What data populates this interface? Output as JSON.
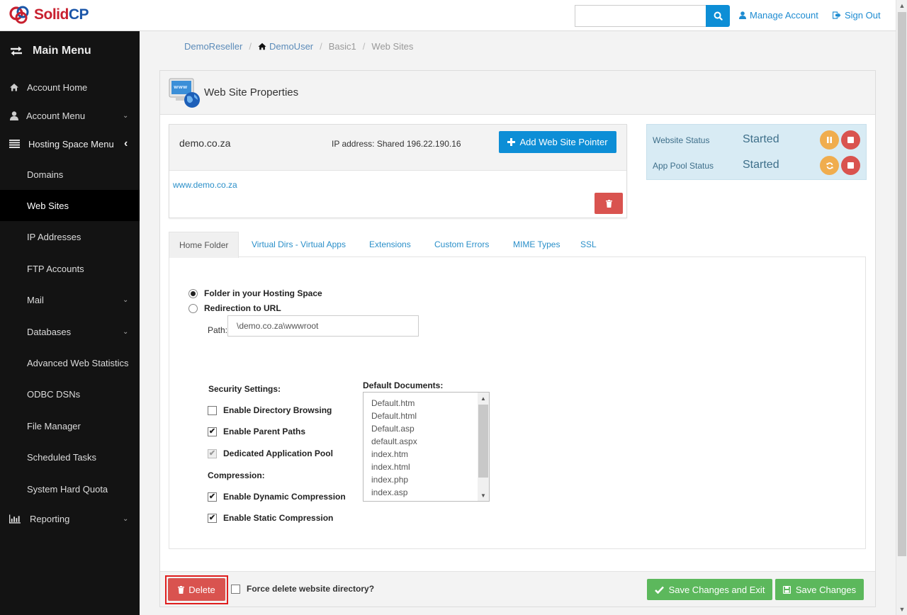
{
  "header": {
    "logo_solid": "Solid",
    "logo_cp": "CP",
    "search": {
      "value": "",
      "placeholder": ""
    },
    "manage_account": "Manage Account",
    "sign_out": "Sign Out"
  },
  "sidebar": {
    "title": "Main Menu",
    "items": [
      {
        "label": "Account Home",
        "icon": "home-icon"
      },
      {
        "label": "Account Menu",
        "icon": "user-icon",
        "chevron": "down"
      },
      {
        "label": "Hosting Space Menu",
        "icon": "list-icon",
        "chevron": "left"
      },
      {
        "label": "Domains"
      },
      {
        "label": "Web Sites",
        "active": true
      },
      {
        "label": "IP Addresses"
      },
      {
        "label": "FTP Accounts"
      },
      {
        "label": "Mail",
        "chevron": "down"
      },
      {
        "label": "Databases",
        "chevron": "down"
      },
      {
        "label": "Advanced Web Statistics"
      },
      {
        "label": "ODBC DSNs"
      },
      {
        "label": "File Manager"
      },
      {
        "label": "Scheduled Tasks"
      },
      {
        "label": "System Hard Quota"
      },
      {
        "label": "Reporting",
        "icon": "bar-chart-icon",
        "chevron": "down"
      }
    ]
  },
  "breadcrumb": {
    "items": [
      "DemoReseller",
      "DemoUser",
      "Basic1",
      "Web Sites"
    ],
    "separator": "/"
  },
  "panel": {
    "title": "Web Site Properties",
    "site": {
      "name": "demo.co.za",
      "ip_address": "IP address: Shared 196.22.190.16",
      "add_pointer_label": "Add Web Site Pointer",
      "pointers": [
        "www.demo.co.za"
      ]
    },
    "status": {
      "website_label": "Website Status",
      "website_value": "Started",
      "app_pool_label": "App Pool Status",
      "app_pool_value": "Started"
    },
    "tabs": [
      {
        "label": "Home Folder",
        "active": true
      },
      {
        "label": "Virtual Dirs - Virtual Apps"
      },
      {
        "label": "Extensions"
      },
      {
        "label": "Custom Errors"
      },
      {
        "label": "MIME Types"
      },
      {
        "label": "SSL"
      }
    ],
    "home_folder": {
      "option_folder": "Folder in your Hosting Space",
      "option_redirect": "Redirection to URL",
      "selected": "folder",
      "path_label": "Path:",
      "path_value": "\\demo.co.za\\wwwroot",
      "security_label": "Security Settings:",
      "security": [
        {
          "label": "Enable Directory Browsing",
          "checked": false,
          "disabled": false
        },
        {
          "label": "Enable Parent Paths",
          "checked": true,
          "disabled": false
        },
        {
          "label": "Dedicated Application Pool",
          "checked": true,
          "disabled": true
        }
      ],
      "compression_label": "Compression:",
      "compression": [
        {
          "label": "Enable Dynamic Compression",
          "checked": true
        },
        {
          "label": "Enable Static Compression",
          "checked": true
        }
      ],
      "default_docs_label": "Default Documents:",
      "default_docs": [
        "Default.htm",
        "Default.html",
        "Default.asp",
        "default.aspx",
        "index.htm",
        "index.html",
        "index.php",
        "index.asp"
      ]
    },
    "footer": {
      "delete_label": "Delete",
      "force_delete_label": "Force delete website directory?",
      "force_delete_checked": false,
      "save_exit_label": "Save Changes and Exit",
      "save_label": "Save Changes"
    }
  },
  "colors": {
    "primary": "#0d8ed6",
    "danger": "#d9534f",
    "warning": "#f0ad4e",
    "success": "#5cb85c",
    "sidebar_bg": "#131313",
    "status_bg": "#d8ebf4"
  }
}
